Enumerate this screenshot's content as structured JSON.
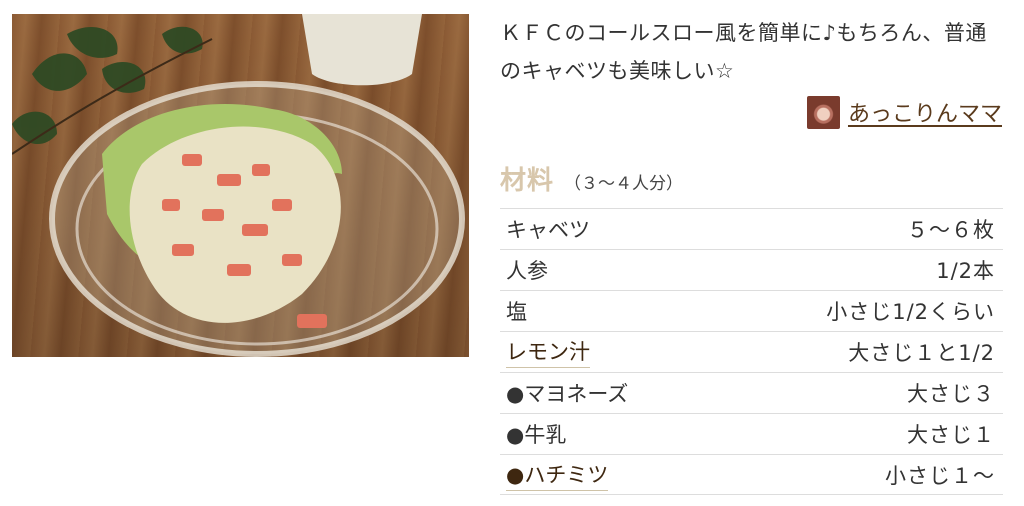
{
  "recipe": {
    "description": "ＫＦＣのコールスロー風を簡単に♪もちろん、普通のキャベツも美味しい☆",
    "author": {
      "name": "あっこりんママ",
      "avatar_icon": "author-avatar"
    }
  },
  "ingredients": {
    "title": "材料",
    "serving": "（３～４人分）",
    "items": [
      {
        "name": "キャベツ",
        "quantity": "５～６枚",
        "link": false
      },
      {
        "name": "人参",
        "quantity": "1/2本",
        "link": false
      },
      {
        "name": "塩",
        "quantity": "小さじ1/2くらい",
        "link": false
      },
      {
        "name": "レモン汁",
        "quantity": "大さじ１と1/2",
        "link": true
      },
      {
        "name": "●マヨネーズ",
        "quantity": "大さじ３",
        "link": false
      },
      {
        "name": "●牛乳",
        "quantity": "大さじ１",
        "link": false
      },
      {
        "name": "●ハチミツ",
        "quantity": "小さじ１～",
        "link": true
      }
    ]
  },
  "colors": {
    "title_accent": "#d8c7ac",
    "link_text": "#3e2710",
    "divider": "#dddddd"
  }
}
